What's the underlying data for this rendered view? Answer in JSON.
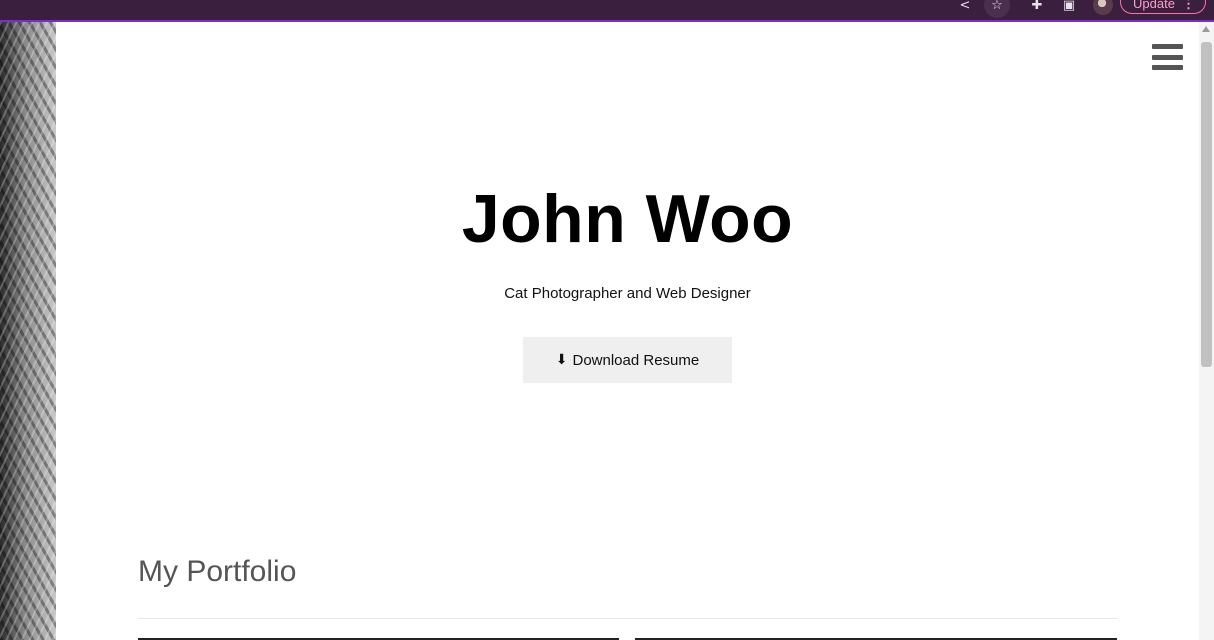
{
  "browser": {
    "update_label": "Update",
    "more_glyph": "⋮",
    "icons": [
      "share-icon",
      "star-icon",
      "extensions-icon",
      "side-panel-icon",
      "profile-avatar-icon"
    ]
  },
  "header": {
    "menu_icon": "hamburger-menu-icon"
  },
  "hero": {
    "title": "John Woo",
    "subtitle": "Cat Photographer and Web Designer",
    "resume_label": "Download Resume",
    "resume_icon": "download-icon"
  },
  "portfolio": {
    "heading": "My Portfolio"
  }
}
